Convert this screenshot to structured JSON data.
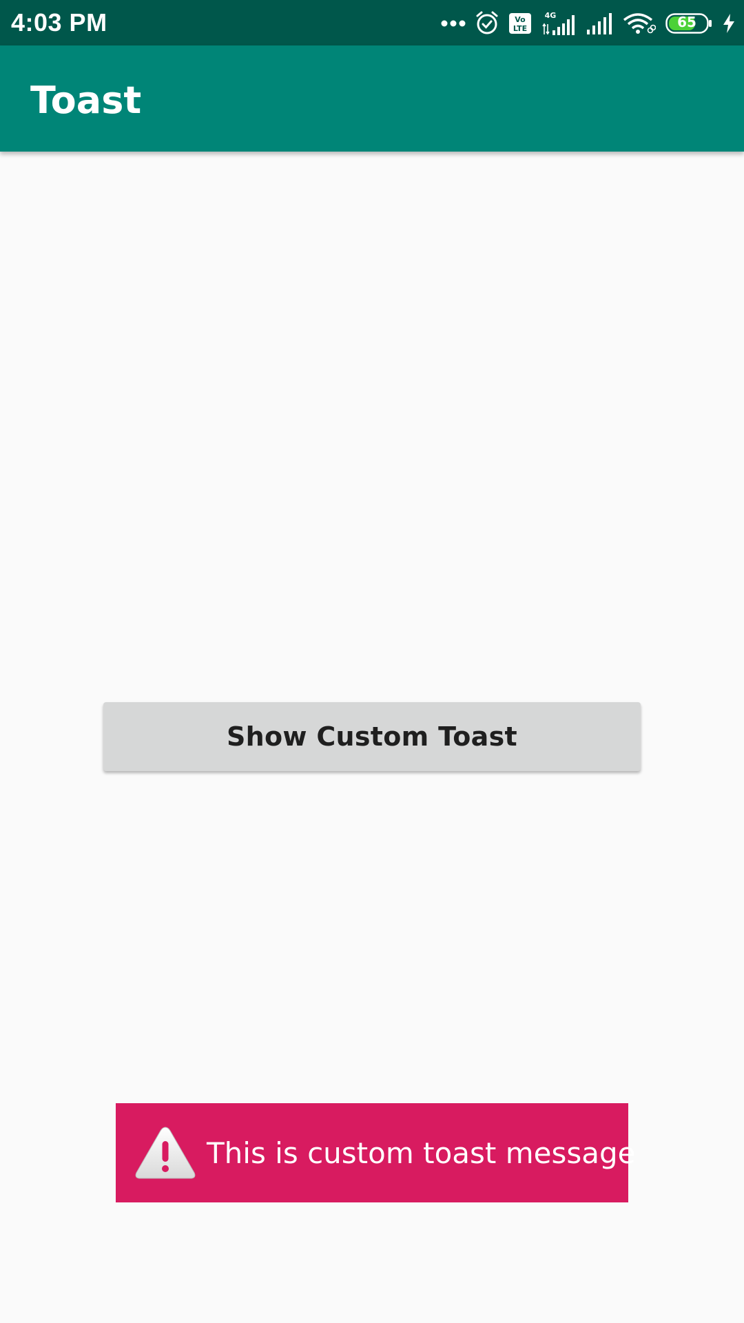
{
  "status_bar": {
    "time": "4:03 PM",
    "network_label": "4G",
    "volte_label": "Vo LTE",
    "battery_level": "65",
    "icons": [
      "more-dots-icon",
      "alarm-icon",
      "volte-icon",
      "signal-4g-icon",
      "signal-icon",
      "wifi-icon",
      "battery-icon",
      "charging-icon"
    ]
  },
  "app_bar": {
    "title": "Toast"
  },
  "main": {
    "button_label": "Show Custom Toast"
  },
  "toast": {
    "message": "This is custom toast message",
    "icon": "warning-icon"
  },
  "colors": {
    "status_bar": "#00574b",
    "primary": "#008577",
    "toast_background": "#d81b60",
    "button_background": "#d6d7d7",
    "page_background": "#fafafa"
  }
}
